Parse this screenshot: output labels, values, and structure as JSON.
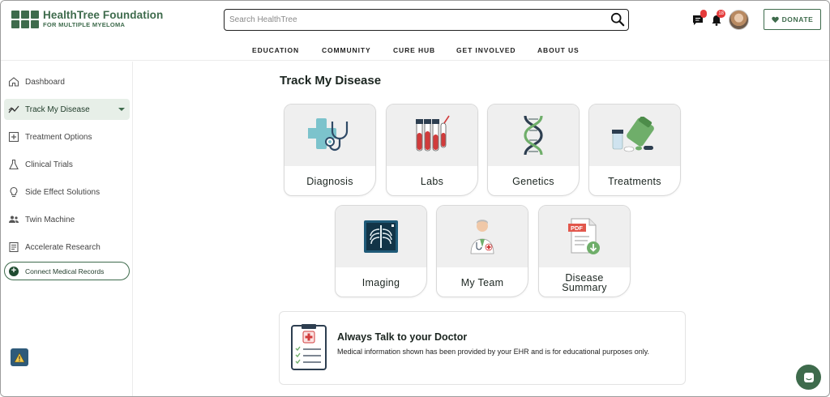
{
  "brand": {
    "name_line1": "HealthTree Foundation",
    "name_line2": "FOR MULTIPLE MYELOMA",
    "color": "#3e6b4c"
  },
  "search": {
    "placeholder": "Search HealthTree",
    "value": ""
  },
  "header": {
    "messages_badge": "",
    "notifications_badge": "18",
    "donate_label": "DONATE"
  },
  "nav": {
    "items": [
      "EDUCATION",
      "COMMUNITY",
      "CURE HUB",
      "GET INVOLVED",
      "ABOUT US"
    ]
  },
  "sidebar": {
    "items": [
      {
        "label": "Dashboard",
        "icon": "home-icon"
      },
      {
        "label": "Track My Disease",
        "icon": "trend-icon",
        "active": true
      },
      {
        "label": "Treatment Options",
        "icon": "plus-square-icon"
      },
      {
        "label": "Clinical Trials",
        "icon": "flask-icon"
      },
      {
        "label": "Side Effect Solutions",
        "icon": "lightbulb-icon"
      },
      {
        "label": "Twin Machine",
        "icon": "people-icon"
      },
      {
        "label": "Accelerate Research",
        "icon": "document-icon"
      }
    ],
    "connect_label": "Connect Medical Records"
  },
  "main": {
    "title": "Track My Disease",
    "cards": [
      {
        "label": "Diagnosis",
        "icon": "stethoscope-cross-icon"
      },
      {
        "label": "Labs",
        "icon": "test-tubes-icon"
      },
      {
        "label": "Genetics",
        "icon": "dna-icon"
      },
      {
        "label": "Treatments",
        "icon": "pills-icon"
      },
      {
        "label": "Imaging",
        "icon": "xray-icon"
      },
      {
        "label": "My Team",
        "icon": "doctor-icon"
      },
      {
        "label": "Disease Summary",
        "icon": "pdf-download-icon"
      }
    ],
    "doctor_notice": {
      "title": "Always Talk to your Doctor",
      "text": "Medical information shown has been provided by your EHR and is for educational purposes only."
    }
  }
}
